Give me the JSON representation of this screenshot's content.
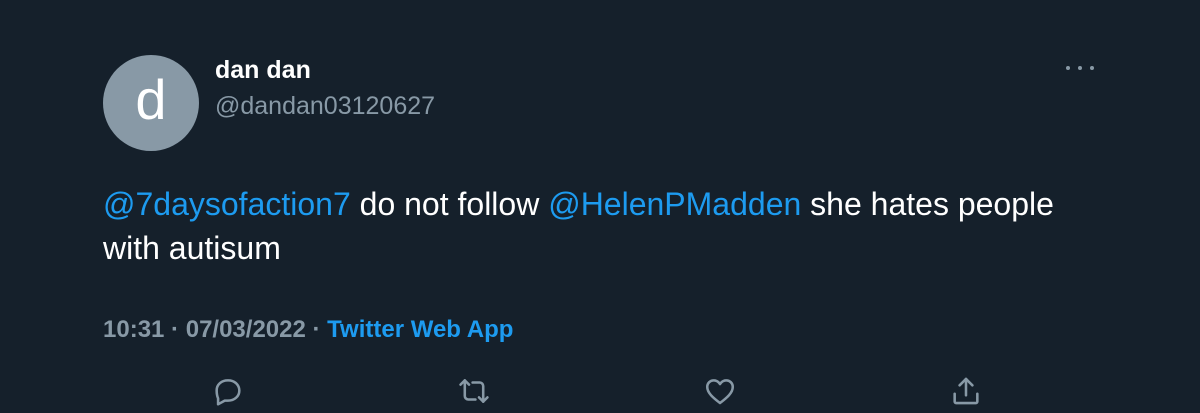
{
  "tweet": {
    "avatar_letter": "d",
    "display_name": "dan dan",
    "handle": "@dandan03120627",
    "text": {
      "mention_1": "@7daysofaction7",
      "part_1": " do not follow ",
      "mention_2": "@HelenPMadden",
      "part_2": " she hates people with autisum"
    },
    "time": "10:31",
    "separator_1": " · ",
    "date": "07/03/2022",
    "separator_2": " · ",
    "source": "Twitter Web App"
  },
  "icons": {
    "more": "more-horizontal-icon",
    "reply": "reply-icon",
    "retweet": "retweet-icon",
    "like": "heart-icon",
    "share": "share-icon"
  },
  "colors": {
    "background": "#15202b",
    "accent": "#1d9bf0",
    "secondary_text": "#8899a6",
    "primary_text": "#ffffff"
  }
}
